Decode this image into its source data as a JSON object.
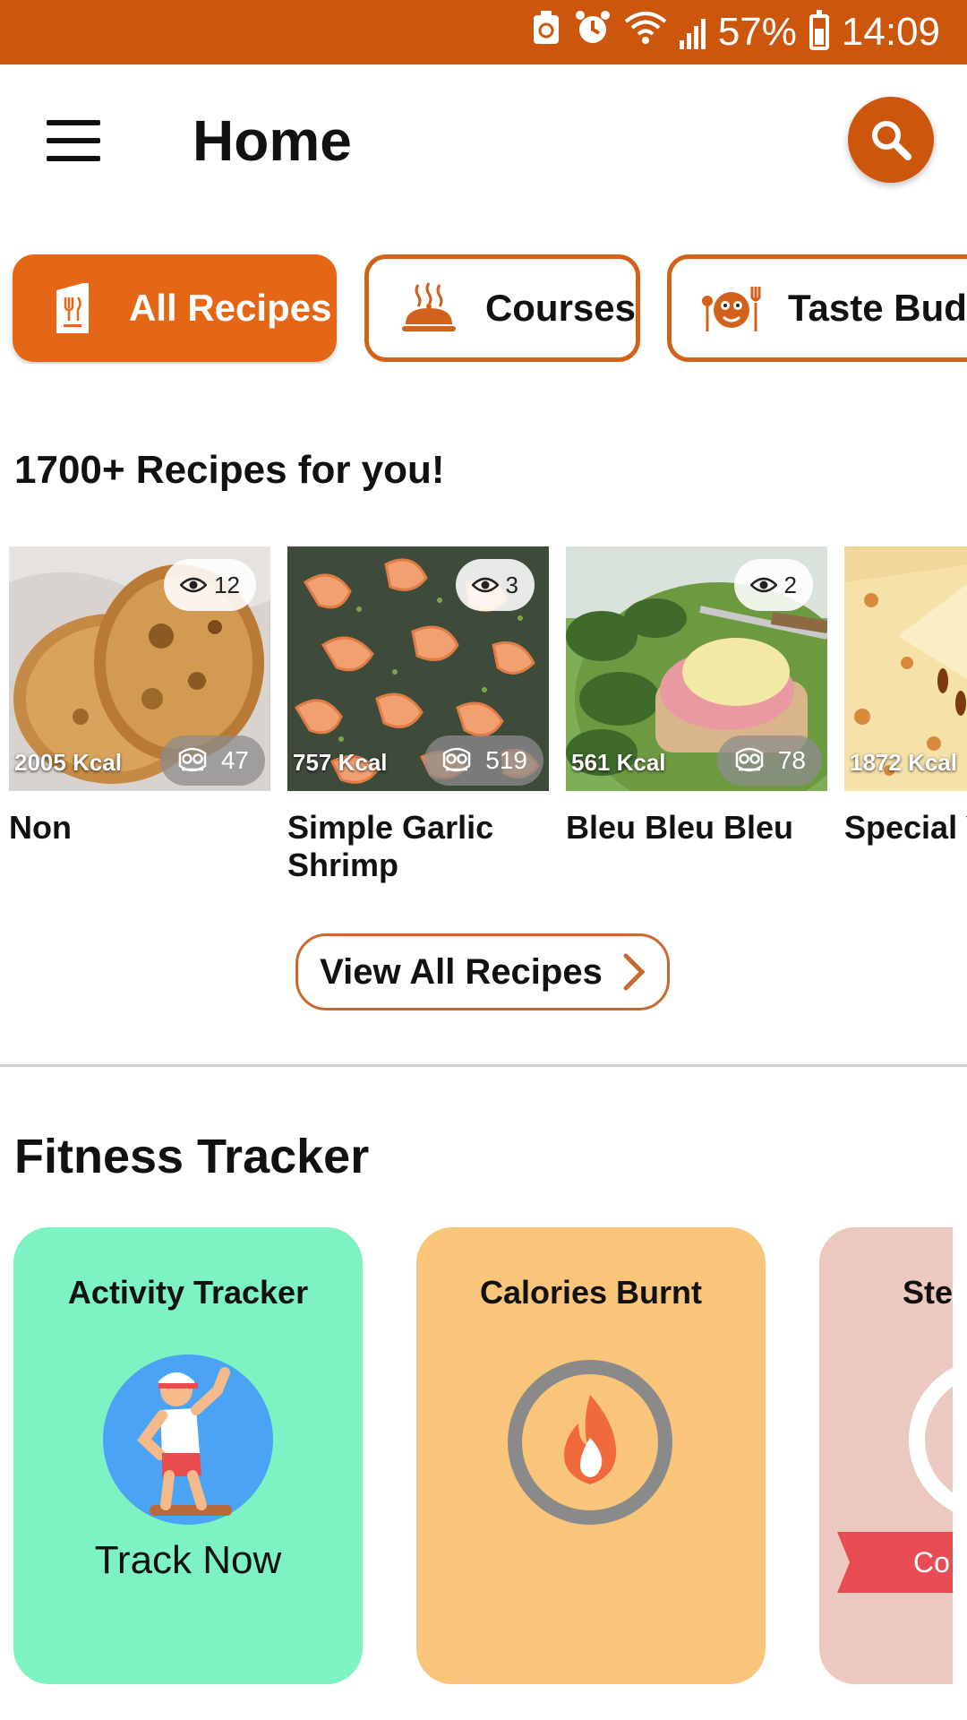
{
  "status_bar": {
    "battery": "57%",
    "time": "14:09"
  },
  "header": {
    "title": "Home"
  },
  "chips": [
    {
      "label": "All Recipes",
      "active": true
    },
    {
      "label": "Courses",
      "active": false
    },
    {
      "label": "Taste Buds",
      "active": false
    }
  ],
  "recipes_section": {
    "title": "1700+ Recipes for you!",
    "items": [
      {
        "name": "Non",
        "kcal": "2005 Kcal",
        "views": "12",
        "cooks": "47"
      },
      {
        "name": "Simple Garlic Shrimp",
        "kcal": "757 Kcal",
        "views": "3",
        "cooks": "519"
      },
      {
        "name": "Bleu Bleu Bleu",
        "kcal": "561 Kcal",
        "views": "2",
        "cooks": "78"
      },
      {
        "name": "Special Yummy",
        "kcal": "1872 Kcal"
      }
    ],
    "view_all_label": "View All Recipes"
  },
  "fitness_section": {
    "title": "Fitness Tracker",
    "cards": [
      {
        "title": "Activity Tracker",
        "action": "Track Now"
      },
      {
        "title": "Calories Burnt"
      },
      {
        "title": "Step",
        "action": "Co"
      }
    ]
  },
  "colors": {
    "brand": "#cd560d",
    "chip_active": "#e56614",
    "activity_card": "#7df2c2",
    "calories_card": "#f9c57a",
    "steps_card": "#ebc9c1"
  },
  "icons": {
    "menu": "hamburger-icon",
    "search": "search-icon",
    "all_recipes": "recipe-book-icon",
    "courses": "serving-dish-icon",
    "taste_buds": "taste-face-icon",
    "views": "eye-icon",
    "cooks": "chef-owl-icon",
    "view_all": "chevron-right-icon"
  }
}
